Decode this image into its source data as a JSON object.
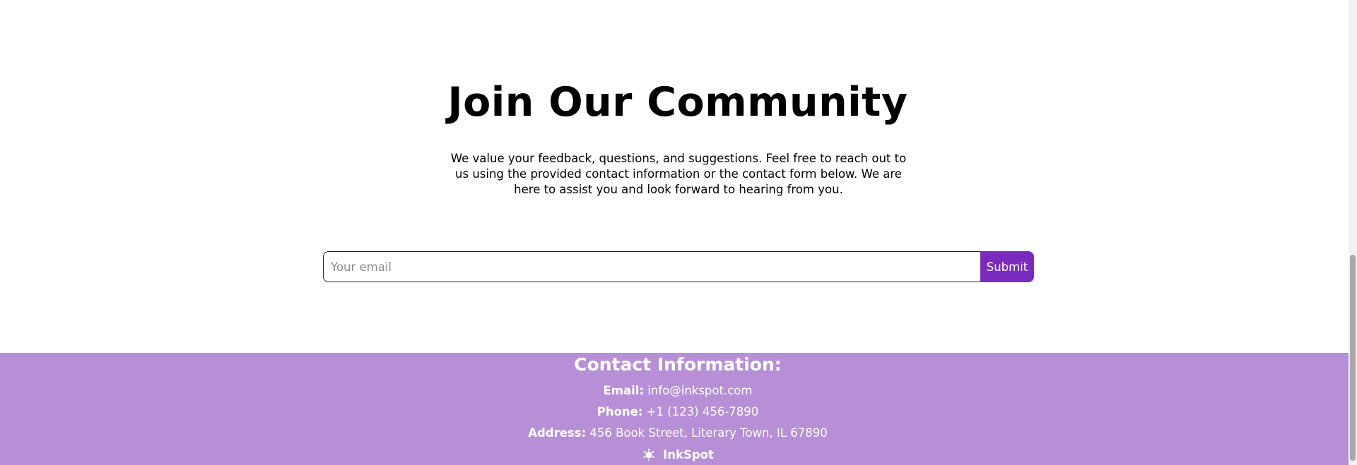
{
  "hero": {
    "title": "Join Our Community",
    "description": "We value your feedback, questions, and suggestions. Feel free to reach out to us using the provided contact information or the contact form below. We are here to assist you and look forward to hearing from you."
  },
  "newsletter": {
    "email_placeholder": "Your email",
    "email_value": "",
    "submit_label": "Submit"
  },
  "footer": {
    "heading": "Contact Information:",
    "email_label": "Email:",
    "email_value": "info@inkspot.com",
    "phone_label": "Phone:",
    "phone_value": "+1 (123) 456-7890",
    "address_label": "Address:",
    "address_value": "456 Book Street, Literary Town, IL 67890",
    "brand_name": "InkSpot",
    "brand_icon": "ink-splat-icon"
  },
  "colors": {
    "accent": "#7b2cbf",
    "footer_bg": "#b68fd6",
    "footer_text": "#ffffff"
  }
}
